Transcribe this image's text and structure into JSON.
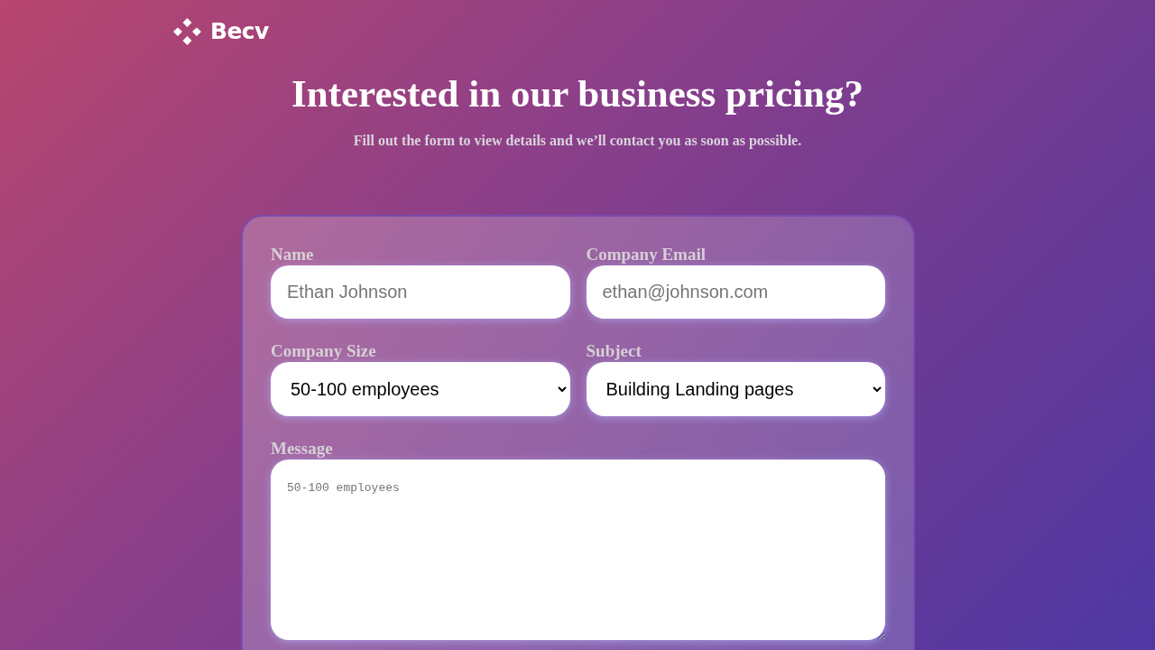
{
  "brand": {
    "name": "Becv"
  },
  "heading": "Interested in our business pricing?",
  "subheading": "Fill out the form to view details and we’ll contact you as soon as possible.",
  "fields": [
    {
      "kind": "input",
      "label": "Name",
      "placeholder": "Ethan Johnson"
    },
    {
      "kind": "input",
      "label": "Company Email",
      "placeholder": "ethan@johnson.com"
    },
    {
      "kind": "select",
      "label": "Company Size",
      "value": "50-100 employees"
    },
    {
      "kind": "select",
      "label": "Subject",
      "value": "Building Landing pages"
    }
  ],
  "message": {
    "label": "Message",
    "placeholder": "50-100 employees"
  }
}
